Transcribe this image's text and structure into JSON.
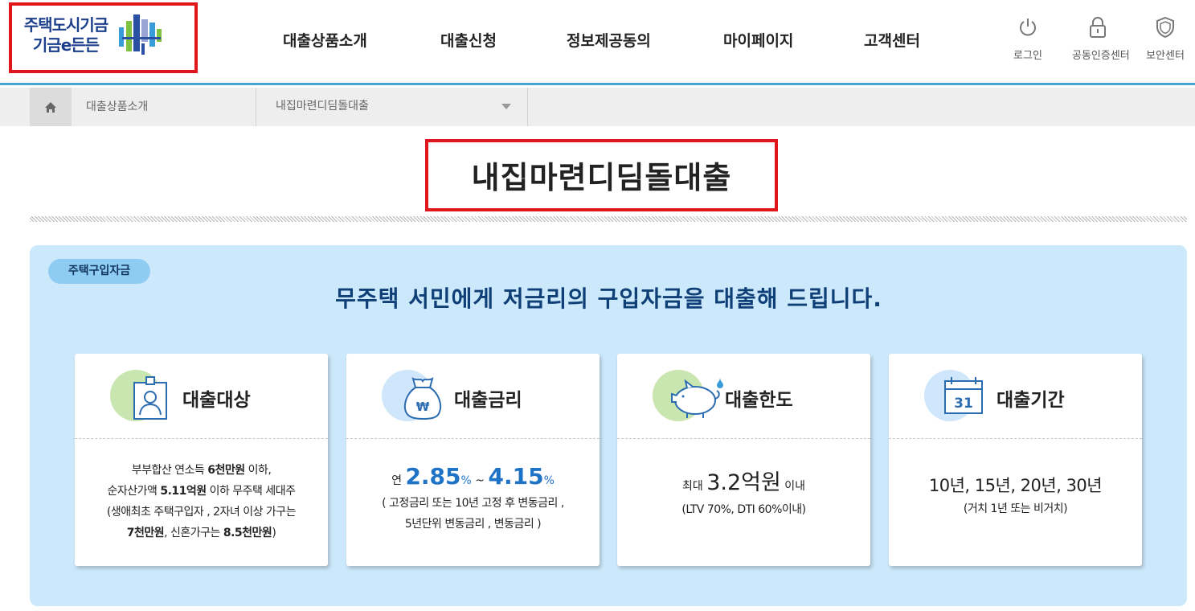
{
  "header": {
    "logo": {
      "line1": "주택도시기금",
      "line2": "기금e든든"
    },
    "nav": [
      "대출상품소개",
      "대출신청",
      "정보제공동의",
      "마이페이지",
      "고객센터"
    ],
    "utils": [
      {
        "label": "로그인",
        "icon": "power-icon"
      },
      {
        "label": "공동인증센터",
        "icon": "lock-icon"
      },
      {
        "label": "보안센터",
        "icon": "shield-icon"
      }
    ],
    "accent_color": "#4aa3d8"
  },
  "breadcrumb": {
    "home_icon": "home-icon",
    "level1": "대출상품소개",
    "level2": "내집마련디딤돌대출"
  },
  "page_title": "내집마련디딤돌대출",
  "panel": {
    "tag": "주택구입자금",
    "headline": "무주택 서민에게 저금리의 구입자금을 대출해 드립니다.",
    "background": "#cce8fb"
  },
  "cards": {
    "target": {
      "title": "대출대상",
      "icon": "id-badge-icon",
      "l1a": "부부합산 연소득 ",
      "l1b": "6천만원",
      "l1c": " 이하,",
      "l2a": "순자산가액 ",
      "l2b": "5.11억원",
      "l2c": " 이하 무주택 세대주",
      "l3": "(생애최초 주택구입자 , 2자녀 이상 가구는",
      "l4a": "7천만원",
      "l4b": ", 신혼가구는 ",
      "l4c": "8.5천만원",
      "l4d": ")"
    },
    "rate": {
      "title": "대출금리",
      "icon": "money-bag-icon",
      "prefix": "연 ",
      "min": "2.85",
      "unit1": "%",
      "sep": " ~ ",
      "max": "4.15",
      "unit2": "%",
      "note1": "( 고정금리 또는 10년 고정 후 변동금리 ,",
      "note2": "5년단위 변동금리 , 변동금리 )"
    },
    "limit": {
      "title": "대출한도",
      "icon": "piggy-bank-icon",
      "prefix": "최대 ",
      "amount": "3.2억원",
      "suffix": " 이내",
      "note": "(LTV 70%, DTI 60%이내)"
    },
    "period": {
      "title": "대출기간",
      "icon": "calendar-icon",
      "calendar_day": "31",
      "value": "10년, 15년, 20년, 30년",
      "note": "(거치 1년 또는 비거치)"
    }
  }
}
